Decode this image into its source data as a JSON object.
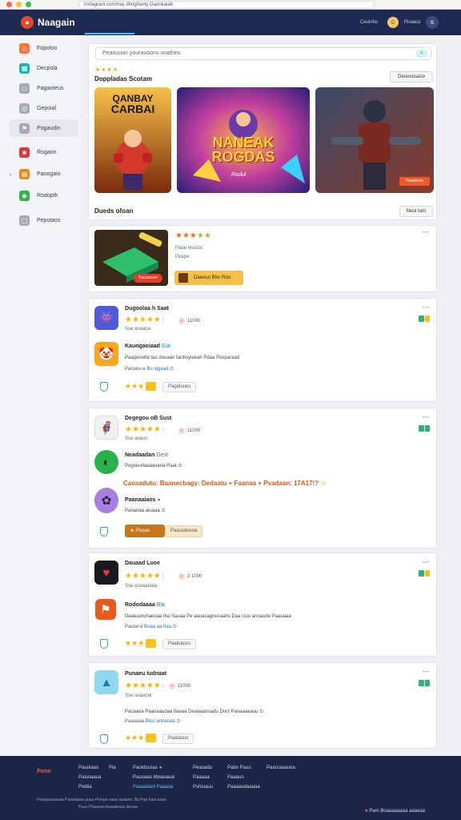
{
  "browser": {
    "url": "instagram.com/hay dhoghanty Gaonkaiab"
  },
  "header": {
    "app_title": "Naagain",
    "btn_1": "Ceuinhs",
    "btn_2": "Pnaaco",
    "avatar_icon": "user-avatar",
    "profile_letter": "s"
  },
  "sidebar": {
    "items": [
      {
        "label": "Fopoloo",
        "icon": "home-icon",
        "color": "#f47a3b"
      },
      {
        "label": "Decpola",
        "icon": "grid-icon",
        "color": "#1fb6a8"
      },
      {
        "label": "Pagaoteus",
        "icon": "folder-icon",
        "color": "#8a8f9c"
      },
      {
        "label": "Gepoial",
        "icon": "gamepad-icon",
        "color": "#8a8f9c"
      },
      {
        "label": "Pogaudin",
        "icon": "flag-icon",
        "color": "#8a8f9c"
      },
      {
        "label": "Rogaon",
        "icon": "bag-icon",
        "color": "#d93a3a"
      },
      {
        "label": "Paoogaio",
        "icon": "chart-icon",
        "color": "#e3891d"
      },
      {
        "label": "Rodopth",
        "icon": "shield-icon",
        "color": "#33b44a"
      },
      {
        "label": "Peputaos",
        "icon": "doc-icon",
        "color": "#8a8f9c"
      }
    ]
  },
  "featured": {
    "search_placeholder": "Peaouuan yourauoons unatheu",
    "stars": "★★★★",
    "title": "Doppladas Scotam",
    "more_button": "Deooousaco",
    "banners": [
      {
        "title_line1": "QANBAY",
        "title_line2": "CARBAI"
      },
      {
        "title_line1": "NANEAK",
        "title_line2": "ROGDAS",
        "tag": "Radul"
      },
      {
        "cta": "Haawioss"
      }
    ],
    "section_footer": "Dueds ofoan",
    "see_all_button": "Neut turn"
  },
  "highlight": {
    "stars": "★★★★★",
    "line1": "Paoe hrudos",
    "line2": "Peapo",
    "action_red": "Facuseom",
    "action_gold": "Daeoun Bhu Roo"
  },
  "cards": [
    {
      "title": "Dugoolaa h Saat",
      "rank": "11000",
      "sub": "Sse aoaaoa",
      "entry_name": "Kaungaoiaad",
      "entry_tag": "Gia",
      "desc": "Paagooutta tau douaan tardloyiaeah Pdaa Pusparaad",
      "link_prefix": "Paoueu e",
      "link": "Bu iqgaaa",
      "pill": "Pagiduuos"
    },
    {
      "title": "Degegou oB Sust",
      "rank": "11000",
      "sub": "Sse aoaon",
      "entry_name": "Neadaadan",
      "entry_tag": "Gest",
      "entry_sub": "Pugoourlaaaavaoa Raat",
      "headline": "Cavaadutu: Baanecbagy: Dedaatu + Faanaa + Pvadaan: 17A17!?",
      "entry2_name": "Paanaaiaos",
      "entry2_sub": "Paoanaa aiuaaa",
      "badge": "Pusao",
      "pill": "Paausduvoa"
    },
    {
      "title": "Dauaad Luoe",
      "rank": "2 1000",
      "sub": "Sse oouaaoala",
      "entry_name": "Rododaaaa",
      "entry_tag": "Bla",
      "desc": "Deaeaoruhaeoaa tha Sauaa Pe aauacagnecaahs Daa Uuu annaudu Paauaaa",
      "link_prefix": "Paoue e",
      "link": "Buaa aa haa",
      "pill": "Paaluaoos"
    },
    {
      "title": "Punaeu Iudnaat",
      "rank": "11000",
      "sub": "Sse uoaaooi",
      "desc": "Pacaaoa Paaoaaudaa tlaaaa Deaaaanuadu Duct Paoaaaaauu",
      "link_prefix": "Paauaaa",
      "link": "Bioo annanaa",
      "pill": "Paataoos"
    }
  ],
  "footer": {
    "logo": "Pooo",
    "columns": [
      [
        "Pauolaao",
        "Pasinaaua",
        "Poldia"
      ],
      [
        "Pia",
        "",
        ""
      ],
      [
        "Paoidsusas",
        "Pauoaao Moaeaeal",
        "Paaaaiiaol Paaaoa"
      ],
      [
        "Peaoadu",
        "Paaaaa",
        "Pshiuauu"
      ],
      [
        "Pabo Pauu",
        "Paaauo",
        "Paaaaudaaaaa"
      ],
      [
        "Paarcaaauoa",
        "",
        ""
      ]
    ],
    "copyright": "Pasupaaaaaaa Paaalaaua puau Pianpa uaaa auaaeo, Ba Pap tuaa uaaa",
    "copyright2": "Puau Paaaraa daaaaeaau duuaa",
    "right": "Pam Boaaaaaaaa aaaeaa"
  }
}
